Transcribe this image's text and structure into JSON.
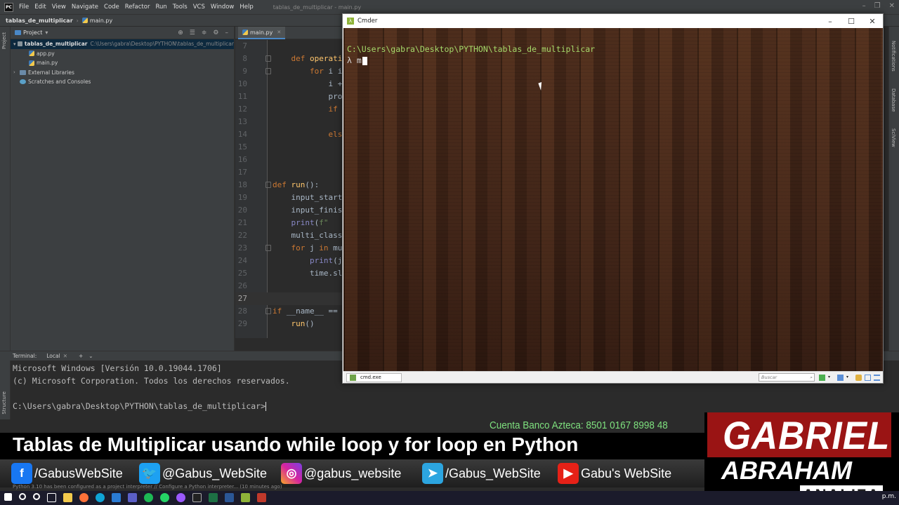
{
  "ide": {
    "menu": [
      "File",
      "Edit",
      "View",
      "Navigate",
      "Code",
      "Refactor",
      "Run",
      "Tools",
      "VCS",
      "Window",
      "Help"
    ],
    "window_title": "tablas_de_multiplicar - main.py",
    "breadcrumb": [
      "tablas_de_multiplicar",
      "main.py"
    ],
    "left_tool_labels": [
      "Project",
      "Structure"
    ],
    "right_tool_labels": [
      "Notifications",
      "Database",
      "SciView"
    ],
    "project_panel": {
      "title": "Project",
      "root_name": "tablas_de_multiplicar",
      "root_path": "C:\\Users\\gabra\\Desktop\\PYTHON\\tablas_de_multiplicar",
      "files": [
        "app.py",
        "main.py"
      ],
      "extra": [
        "External Libraries",
        "Scratches and Consoles"
      ]
    },
    "editor_tab": "main.py",
    "code_lines": [
      {
        "n": "7",
        "code": ""
      },
      {
        "n": "8",
        "code": "    def operati"
      },
      {
        "n": "9",
        "code": "        for i i"
      },
      {
        "n": "10",
        "code": "            i +"
      },
      {
        "n": "11",
        "code": "            pro"
      },
      {
        "n": "12",
        "code": "            if "
      },
      {
        "n": "13",
        "code": ""
      },
      {
        "n": "14",
        "code": "            els"
      },
      {
        "n": "15",
        "code": ""
      },
      {
        "n": "16",
        "code": ""
      },
      {
        "n": "17",
        "code": ""
      },
      {
        "n": "18",
        "code": "def run():"
      },
      {
        "n": "19",
        "code": "    input_start"
      },
      {
        "n": "20",
        "code": "    input_finis"
      },
      {
        "n": "21",
        "code": "    print(f\""
      },
      {
        "n": "22",
        "code": "    multi_class"
      },
      {
        "n": "23",
        "code": "    for j in mu"
      },
      {
        "n": "24",
        "code": "        print(j"
      },
      {
        "n": "25",
        "code": "        time.sl"
      },
      {
        "n": "26",
        "code": ""
      },
      {
        "n": "27",
        "code": ""
      },
      {
        "n": "28",
        "code": "if __name__ == "
      },
      {
        "n": "29",
        "code": "    run()"
      }
    ],
    "terminal": {
      "label": "Terminal:",
      "tab": "Local",
      "lines": [
        "Microsoft Windows [Versión 10.0.19044.1706]",
        "(c) Microsoft Corporation. Todos los derechos reservados.",
        "",
        "C:\\Users\\gabra\\Desktop\\PYTHON\\tablas_de_multiplicar>"
      ]
    },
    "status_text": "Python 3.10 has been configured as a project interpreter // Configure a Python interpreter... (10 minutes ago)"
  },
  "cmder": {
    "title": "Cmder",
    "path": "C:\\Users\\gabra\\Desktop\\PYTHON\\tablas_de_multiplicar",
    "prompt": "λ m",
    "tab_label": "cmd.exe",
    "search_placeholder": "Buscar"
  },
  "overlay": {
    "bank": "Cuenta Banco Azteca: 8501 0167 8998 48",
    "title": "Tablas de Multiplicar usando while loop y for loop en Python",
    "socials": [
      {
        "icon": "facebook-icon",
        "label": "/GabusWebSite",
        "color": "#1877f2"
      },
      {
        "icon": "twitter-icon",
        "label": "@Gabus_WebSite",
        "color": "#1da1f2"
      },
      {
        "icon": "instagram-icon",
        "label": "@gabus_website",
        "color": "#d6249f"
      },
      {
        "icon": "telegram-icon",
        "label": "/Gabus_WebSite",
        "color": "#2ca5e0"
      },
      {
        "icon": "youtube-icon",
        "label": "Gabu's WebSite",
        "color": "#e62117"
      }
    ],
    "brand_first": "GABRIEL",
    "brand_last": "ABRAHAM",
    "brand_tag": "ANALIZA"
  },
  "taskbar": {
    "clock": "p.m."
  },
  "colors": {
    "ide_bg": "#2b2b2b",
    "keyword": "#cc7832",
    "function": "#ffc66d",
    "cmder_path": "#a6d96a",
    "brand_red": "#9a1414",
    "bank_green": "#7ee07e"
  }
}
